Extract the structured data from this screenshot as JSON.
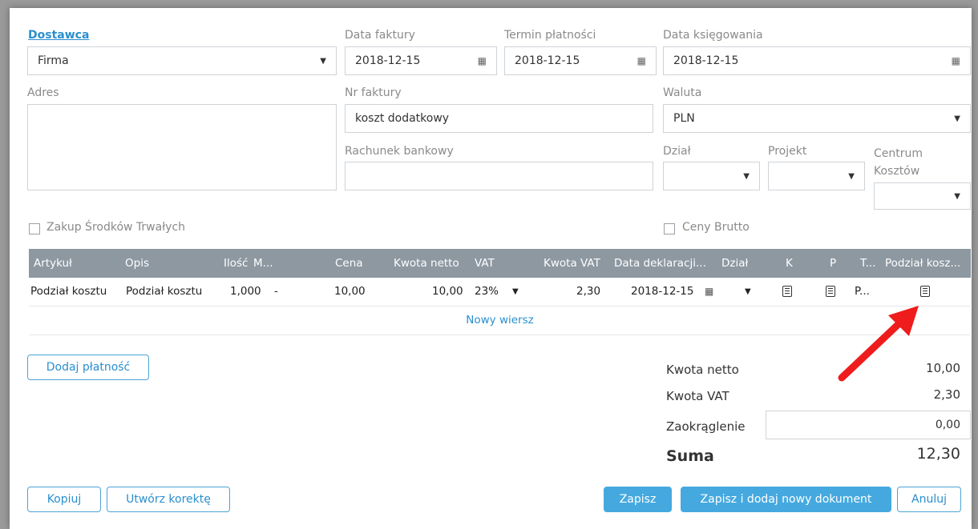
{
  "supplier": {
    "label": "Dostawca",
    "value": "Firma"
  },
  "invoice_date": {
    "label": "Data faktury",
    "value": "2018-12-15"
  },
  "due_date": {
    "label": "Termin płatności",
    "value": "2018-12-15"
  },
  "booking_date": {
    "label": "Data księgowania",
    "value": "2018-12-15"
  },
  "address": {
    "label": "Adres",
    "value": ""
  },
  "invoice_no": {
    "label": "Nr faktury",
    "value": "koszt dodatkowy"
  },
  "currency": {
    "label": "Waluta",
    "value": "PLN"
  },
  "bank_account": {
    "label": "Rachunek bankowy",
    "value": ""
  },
  "department": {
    "label": "Dział",
    "value": ""
  },
  "project": {
    "label": "Projekt",
    "value": ""
  },
  "cost_center": {
    "label": "Centrum Kosztów",
    "value": ""
  },
  "checkboxes": {
    "fixed_assets": "Zakup Środków Trwałych",
    "gross_prices": "Ceny Brutto"
  },
  "table": {
    "headers": [
      "Artykuł",
      "Opis",
      "Ilość",
      "M...",
      "Cena",
      "Kwota netto",
      "VAT",
      "Kwota VAT",
      "Data deklaracji...",
      "Dział",
      "K",
      "P",
      "T...",
      "Podział kosz..."
    ],
    "row": {
      "article": "Podział kosztu",
      "description": "Podział kosztu",
      "qty": "1,000",
      "unit": "-",
      "price": "10,00",
      "net": "10,00",
      "vat": "23%",
      "vat_amount": "2,30",
      "decl_date": "2018-12-15",
      "dept": "",
      "t": "P..."
    },
    "new_row": "Nowy wiersz"
  },
  "buttons": {
    "add_payment": "Dodaj płatność",
    "copy": "Kopiuj",
    "correction": "Utwórz korektę",
    "save": "Zapisz",
    "save_new": "Zapisz i dodaj nowy dokument",
    "cancel": "Anuluj"
  },
  "summary": {
    "net_label": "Kwota netto",
    "net_value": "10,00",
    "vat_label": "Kwota VAT",
    "vat_value": "2,30",
    "rounding_label": "Zaokrąglenie",
    "rounding_value": "0,00",
    "total_label": "Suma",
    "total_value": "12,30"
  },
  "colors": {
    "accent": "#2a8fce",
    "header": "#8d98a1",
    "arrow": "#ee1c1c"
  }
}
